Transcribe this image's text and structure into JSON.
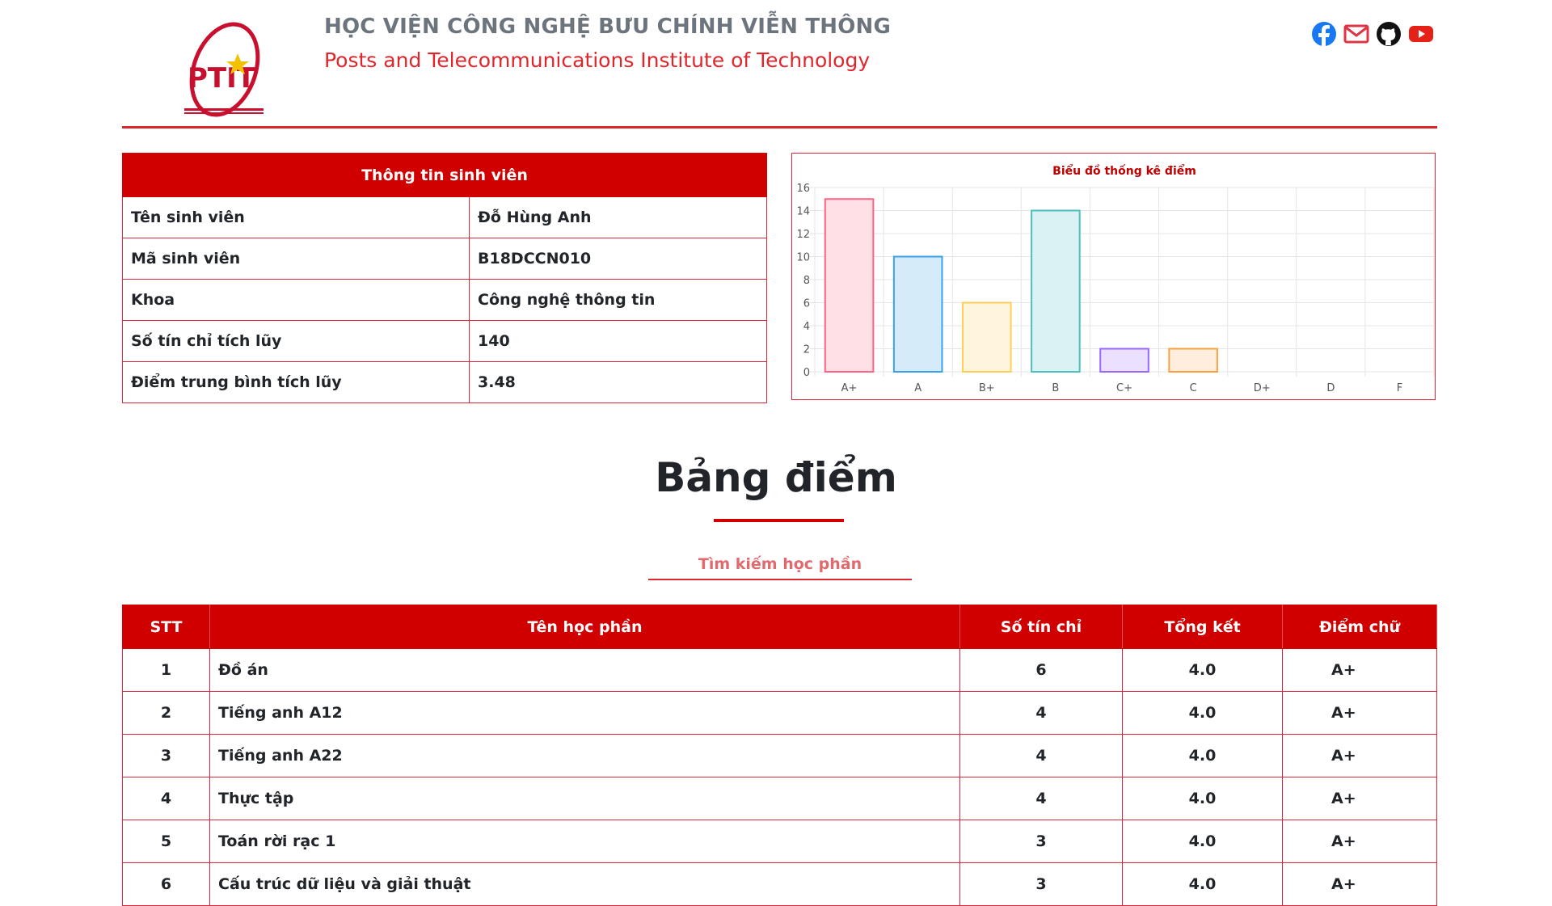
{
  "header": {
    "title_vn": "HỌC VIỆN CÔNG NGHỆ BƯU CHÍNH VIỄN THÔNG",
    "title_en": "Posts and Telecommunications Institute of Technology",
    "logo_text": "PTIT",
    "socials": [
      "facebook-icon",
      "email-icon",
      "github-icon",
      "youtube-icon"
    ]
  },
  "student": {
    "table_title": "Thông tin sinh viên",
    "rows": [
      {
        "label": "Tên sinh viên",
        "value": "Đỗ Hùng Anh"
      },
      {
        "label": "Mã sinh viên",
        "value": "B18DCCN010"
      },
      {
        "label": "Khoa",
        "value": "Công nghệ thông tin"
      },
      {
        "label": "Số tín chỉ tích lũy",
        "value": "140"
      },
      {
        "label": "Điểm trung bình tích lũy",
        "value": "3.48"
      }
    ]
  },
  "chart_data": {
    "type": "bar",
    "title": "Biểu đồ thống kê điểm",
    "categories": [
      "A+",
      "A",
      "B+",
      "B",
      "C+",
      "C",
      "D+",
      "D",
      "F"
    ],
    "values": [
      15,
      10,
      6,
      14,
      2,
      2,
      0,
      0,
      0
    ],
    "ylim": [
      0,
      16
    ],
    "yticks": [
      0,
      2,
      4,
      6,
      8,
      10,
      12,
      14,
      16
    ],
    "grid": true,
    "colors": {
      "fills": [
        "#ffe0e6",
        "#d6ebf9",
        "#fff4dc",
        "#dbf2f2",
        "#ebe0ff",
        "#ffeedd"
      ],
      "strokes": [
        "#ff6384",
        "#36a2eb",
        "#ffce56",
        "#4bc0c0",
        "#9966ff",
        "#ff9f40"
      ]
    }
  },
  "grades": {
    "heading": "Bảng điểm",
    "search_placeholder": "Tìm kiếm học phần",
    "columns": [
      "STT",
      "Tên học phần",
      "Số tín chỉ",
      "Tổng kết",
      "Điểm chữ"
    ],
    "rows": [
      [
        "1",
        "Đồ án",
        "6",
        "4.0",
        "A+"
      ],
      [
        "2",
        "Tiếng anh A12",
        "4",
        "4.0",
        "A+"
      ],
      [
        "3",
        "Tiếng anh A22",
        "4",
        "4.0",
        "A+"
      ],
      [
        "4",
        "Thực tập",
        "4",
        "4.0",
        "A+"
      ],
      [
        "5",
        "Toán rời rạc 1",
        "3",
        "4.0",
        "A+"
      ],
      [
        "6",
        "Cấu trúc dữ liệu và giải thuật",
        "3",
        "4.0",
        "A+"
      ]
    ]
  },
  "theme": {
    "accent": "#d10000",
    "border": "#e0263b"
  }
}
